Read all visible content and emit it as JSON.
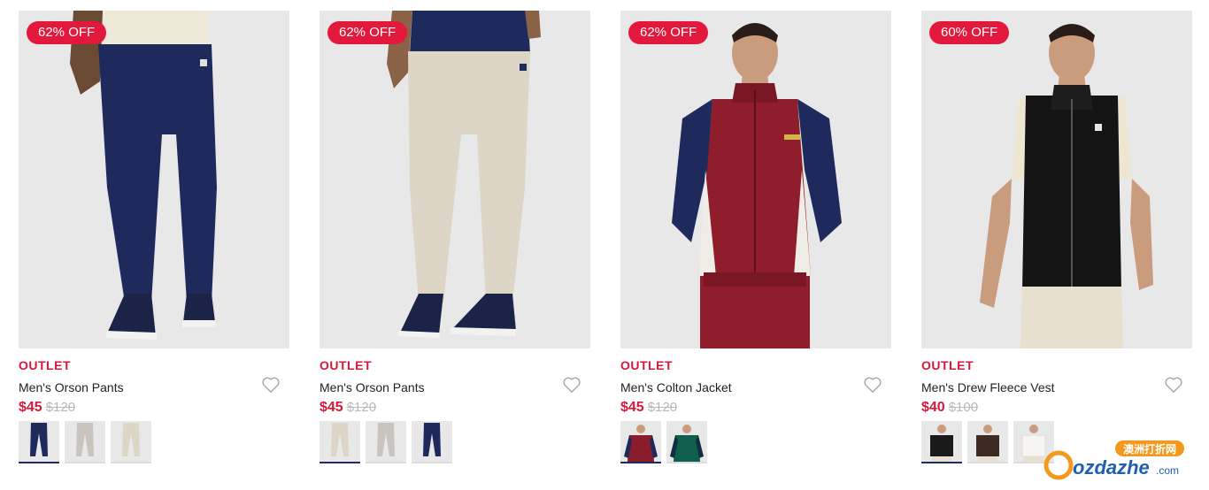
{
  "products": [
    {
      "badge": "62% OFF",
      "tag": "OUTLET",
      "name": "Men's Orson Pants",
      "price": "$45",
      "old_price": "$120",
      "image": "navy-pants-photo",
      "swatch_colors": [
        "#1f2a5c",
        "#c9c5be",
        "#ddd6c6"
      ]
    },
    {
      "badge": "62% OFF",
      "tag": "OUTLET",
      "name": "Men's Orson Pants",
      "price": "$45",
      "old_price": "$120",
      "image": "beige-pants-photo",
      "swatch_colors": [
        "#ddd6c6",
        "#c9c5be",
        "#1f2a5c"
      ]
    },
    {
      "badge": "62% OFF",
      "tag": "OUTLET",
      "name": "Men's Colton Jacket",
      "price": "$45",
      "old_price": "$120",
      "image": "maroon-jacket-photo",
      "swatch_colors": [
        "#8a1d2b",
        "#0f5e4e"
      ]
    },
    {
      "badge": "60% OFF",
      "tag": "OUTLET",
      "name": "Men's Drew Fleece Vest",
      "price": "$40",
      "old_price": "$100",
      "image": "black-vest-photo",
      "swatch_colors": [
        "#1a1a1a",
        "#3d2a22",
        "#f4f2ee"
      ]
    }
  ],
  "icons": {
    "wishlist": "heart-icon"
  },
  "colors": {
    "sale_red": "#d8173a",
    "badge_red": "#e2183d",
    "selected_swatch": "#1f2b5e"
  },
  "watermark": {
    "chinese": "澳洲打折网",
    "brand": "ozdazhe",
    "tld": ".com"
  }
}
